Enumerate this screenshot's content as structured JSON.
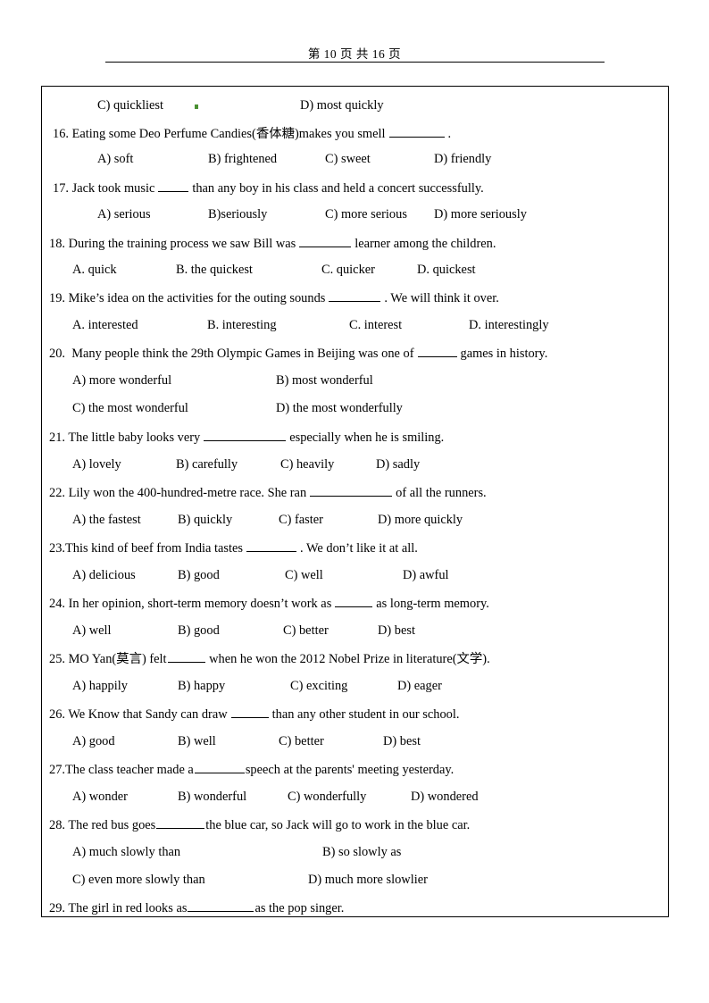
{
  "header": {
    "page_label": "第 10 页 共 16 页"
  },
  "marks": {
    "green_dot": "green-square-mark"
  },
  "continued_options": {
    "c_label": "C) quickliest",
    "d_label": "D) most quickly"
  },
  "questions": [
    {
      "number": "16.",
      "stem_pre": "Eating some Deo Perfume Candies(香体糖)makes you smell",
      "stem_post": ".",
      "options": [
        "A) soft",
        "B) frightened",
        "C) sweet",
        "D) friendly"
      ]
    },
    {
      "number": "17.",
      "stem_pre": "Jack took music",
      "stem_post": "than any boy in his class and held a concert successfully.",
      "options": [
        "A) serious",
        "B)seriously",
        "C) more serious",
        "D) more seriously"
      ]
    },
    {
      "number": "18.",
      "stem_pre": "During the training process we saw Bill was",
      "stem_post": "learner among the children.",
      "options": [
        "A. quick",
        "B. the quickest",
        "C. quicker",
        "D. quickest"
      ]
    },
    {
      "number": "19.",
      "stem_pre": "Mike’s idea on the activities for the outing sounds",
      "stem_post": ". We will think it over.",
      "options": [
        "A. interested",
        "B. interesting",
        "C. interest",
        "D. interestingly"
      ]
    },
    {
      "number": "20.",
      "stem_pre": "Many people think the 29th Olympic Games in Beijing was one of",
      "stem_post": "games in history.",
      "options": [
        "A) more wonderful",
        "B) most wonderful",
        "C) the most wonderful",
        "D) the most wonderfully"
      ]
    },
    {
      "number": "21.",
      "stem_pre": "The little baby looks very",
      "stem_post": "especially when he is smiling.",
      "options": [
        "A) lovely",
        "B) carefully",
        "C) heavily",
        "D) sadly"
      ]
    },
    {
      "number": "22.",
      "stem_pre": "Lily won the 400-hundred-metre race. She ran",
      "stem_post": "of all the runners.",
      "options": [
        "A) the fastest",
        "B) quickly",
        "C) faster",
        "D) more quickly"
      ]
    },
    {
      "number": "23.",
      "stem_pre": "This kind of beef from India tastes",
      "stem_post": ". We don’t like it at all.",
      "options": [
        "A) delicious",
        "B) good",
        "C) well",
        "D) awful"
      ]
    },
    {
      "number": "24.",
      "stem_pre": "In her opinion, short-term memory doesn’t work as",
      "stem_post": "as long-term memory.",
      "options": [
        "A) well",
        "B) good",
        "C) better",
        "D) best"
      ]
    },
    {
      "number": "25.",
      "stem_pre": "MO Yan(莫言) felt",
      "stem_post": "when he won the 2012 Nobel Prize in literature(文学).",
      "options": [
        "A) happily",
        "B) happy",
        "C) exciting",
        "D) eager"
      ]
    },
    {
      "number": "26.",
      "stem_pre": "We Know that Sandy can draw",
      "stem_post": "than any other student in our school.",
      "options": [
        "A) good",
        "B) well",
        "C) better",
        "D) best"
      ]
    },
    {
      "number": "27.",
      "stem_pre": "The class teacher made a",
      "stem_post": "speech at the parents' meeting yesterday.",
      "options": [
        "A) wonder",
        "B) wonderful",
        "C) wonderfully",
        "D) wondered"
      ]
    },
    {
      "number": "28.",
      "stem_pre": "The red bus goes",
      "stem_post": "the blue car, so Jack will go to work in the blue car.",
      "options": [
        "A) much slowly than",
        "B) so slowly as",
        "C) even more slowly than",
        "D) much more slowlier"
      ]
    },
    {
      "number": "29.",
      "stem_pre": "The girl in red looks as",
      "stem_post": "as the pop singer.",
      "options": []
    }
  ]
}
